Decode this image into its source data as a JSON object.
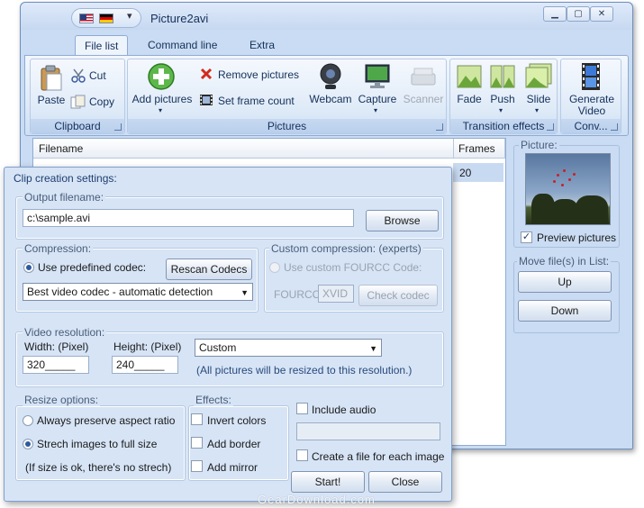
{
  "window": {
    "title": "Picture2avi",
    "logo_glyph": "2",
    "controls": {
      "minimize": "▁",
      "maximize": "▢",
      "close": "✕"
    },
    "qat_dropdown": "▾"
  },
  "tabs": [
    {
      "label": "File list",
      "active": true
    },
    {
      "label": "Command line",
      "active": false
    },
    {
      "label": "Extra",
      "active": false
    }
  ],
  "ribbon": {
    "clipboard": {
      "label": "Clipboard",
      "paste": "Paste",
      "cut": "Cut",
      "copy": "Copy"
    },
    "pictures": {
      "label": "Pictures",
      "add": "Add pictures",
      "remove": "Remove pictures",
      "frame_count": "Set frame count",
      "webcam": "Webcam",
      "capture": "Capture",
      "scanner": "Scanner"
    },
    "transitions": {
      "label": "Transition effects",
      "fade": "Fade",
      "push": "Push",
      "slide": "Slide"
    },
    "convert": {
      "label": "Conv...",
      "generate_line1": "Generate",
      "generate_line2": "Video"
    }
  },
  "file_list": {
    "columns": [
      "Filename",
      "Frames"
    ],
    "row_frames": "20"
  },
  "right_panel": {
    "picture_label": "Picture:",
    "preview_label": "Preview pictures",
    "preview_checked": "✓",
    "move_label": "Move file(s) in List:",
    "up": "Up",
    "down": "Down"
  },
  "dialog": {
    "title": "Clip creation settings:",
    "output": {
      "label": "Output filename:",
      "value": "c:\\sample.avi",
      "browse": "Browse"
    },
    "compression": {
      "label": "Compression:",
      "predefined": "Use predefined codec:",
      "rescan": "Rescan Codecs",
      "codec_value": "Best video codec - automatic detection"
    },
    "custom": {
      "label": "Custom compression: (experts)",
      "use_custom": "Use custom FOURCC Code:",
      "fourcc_label": "FOURCC:",
      "fourcc_value": "XVID",
      "check": "Check codec"
    },
    "resolution": {
      "label": "Video resolution:",
      "width_label": "Width: (Pixel)",
      "height_label": "Height: (Pixel)",
      "width_value": "320_____",
      "height_value": "240_____",
      "preset_value": "Custom",
      "hint": "(All pictures will be resized to this resolution.)"
    },
    "resize": {
      "label": "Resize options:",
      "preserve": "Always preserve aspect ratio",
      "stretch": "Strech images to full size",
      "note": "(If size is ok, there's no strech)"
    },
    "effects": {
      "label": "Effects:",
      "invert": "Invert colors",
      "border": "Add border",
      "mirror": "Add mirror"
    },
    "audio": {
      "include": "Include audio",
      "per_image": "Create a file for each image"
    },
    "start": "Start!",
    "close": "Close"
  },
  "watermark": "GearDownload.com",
  "colors": {
    "accent": "#2c5aa0",
    "window_bg": "#c9dcf3",
    "dialog_bg": "#d6e4f6"
  }
}
